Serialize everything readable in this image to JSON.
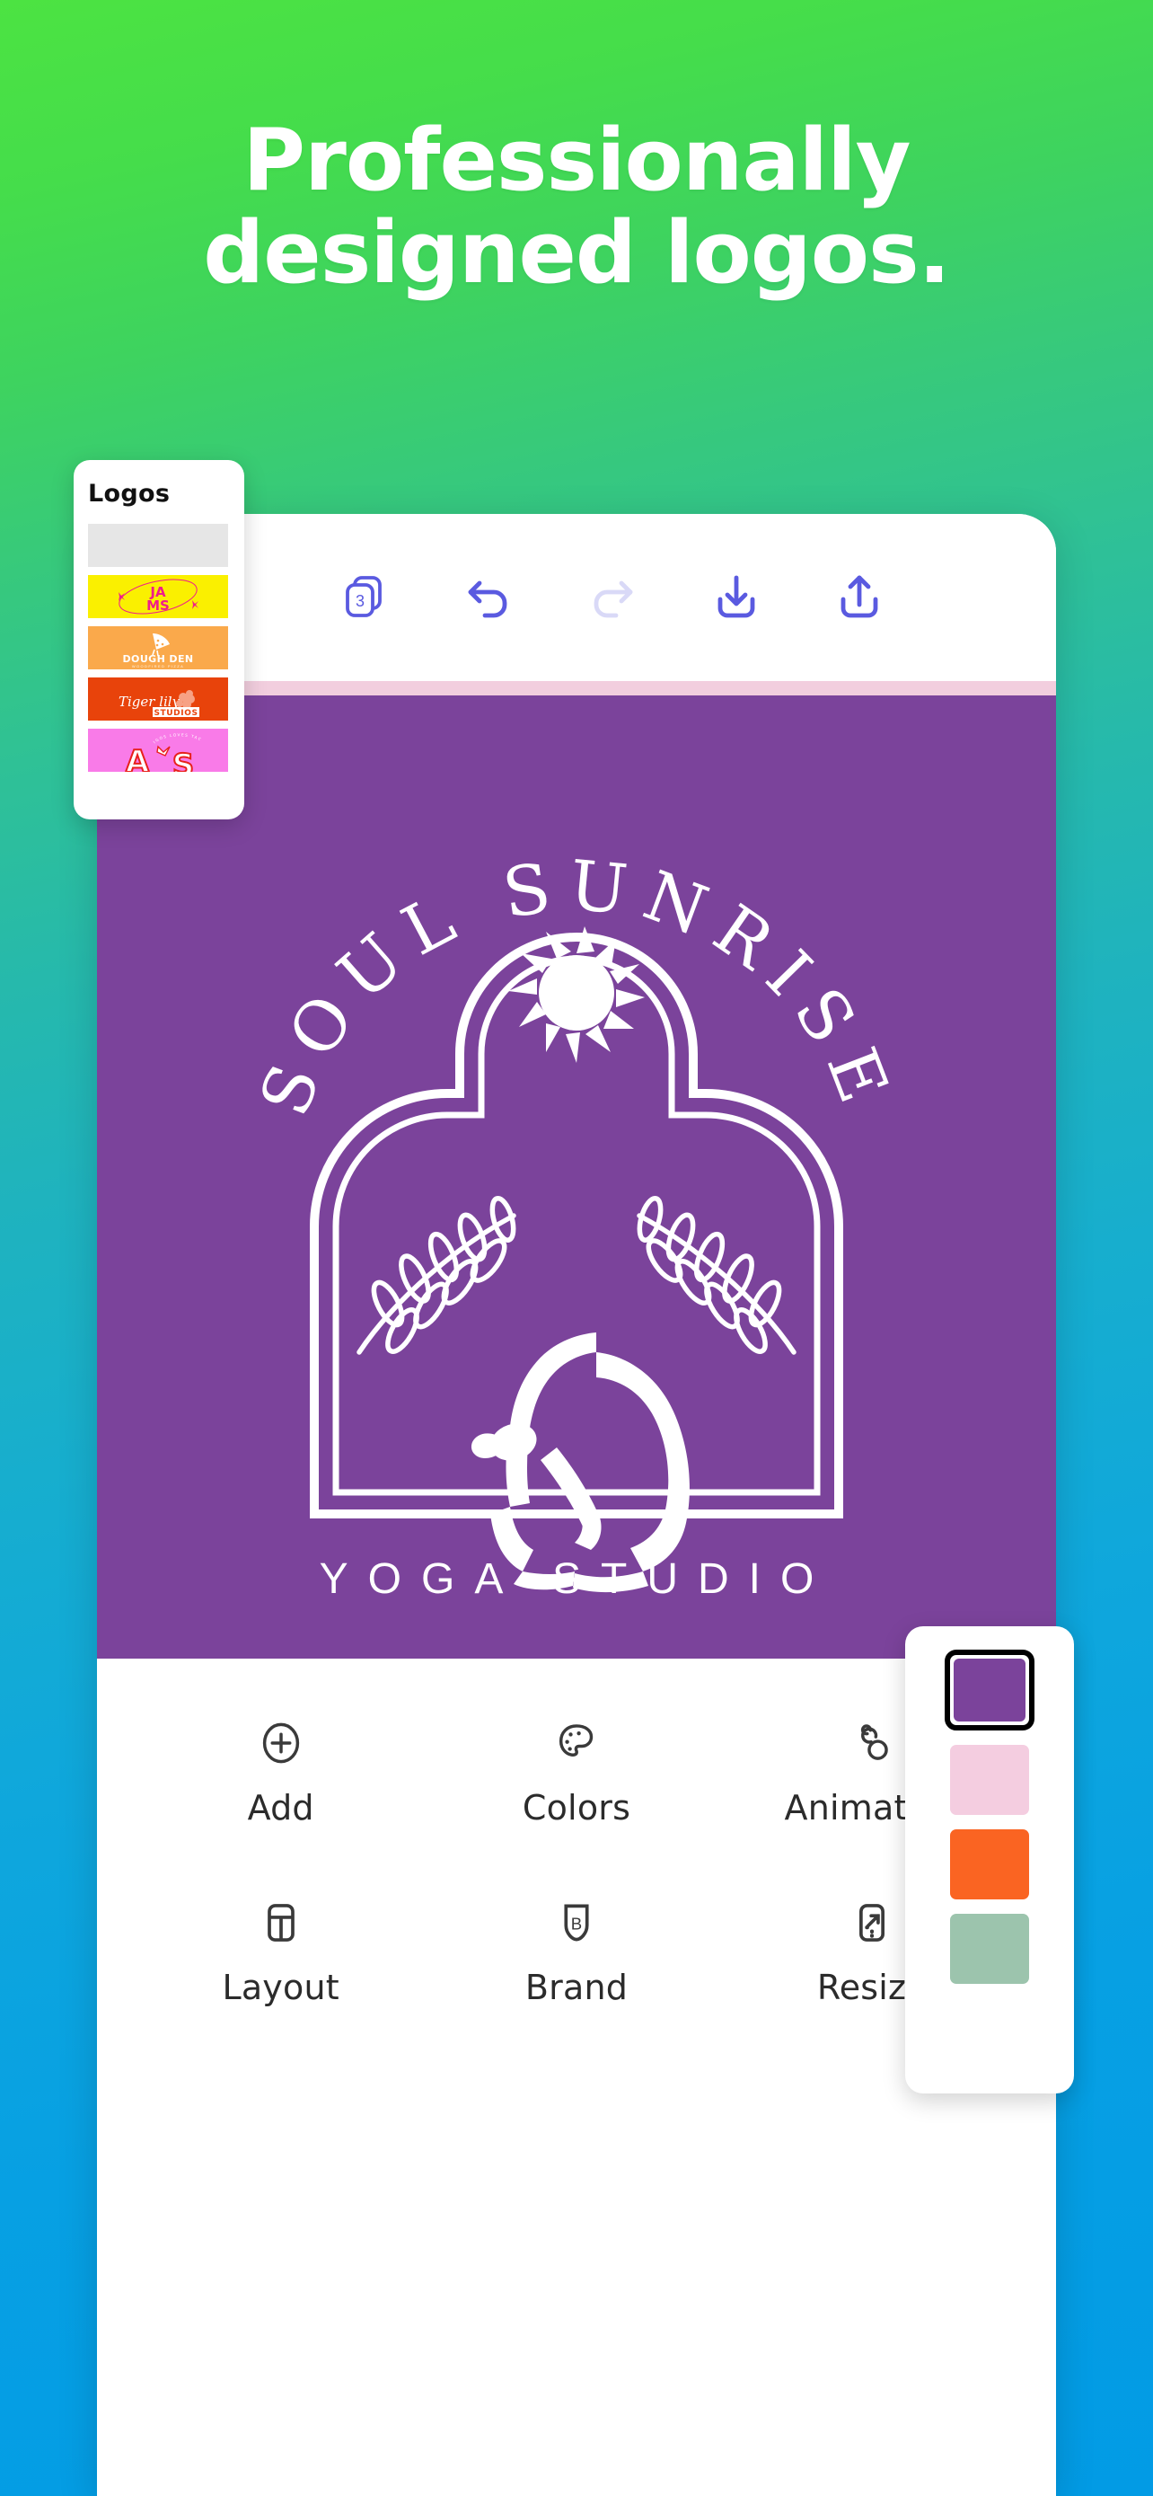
{
  "headline": {
    "line1": "Professionally",
    "line2": "designed logos."
  },
  "background": {
    "gradient_from": "#4CE342",
    "gradient_mid": "#1FB3BE",
    "gradient_to": "#029BE5"
  },
  "app": {
    "top_toolbar": {
      "pages": {
        "label": "Pages",
        "badge": "3",
        "icon": "pages-icon",
        "color": "#5A5AE0"
      },
      "undo": {
        "label": "Undo",
        "icon": "undo-icon",
        "color": "#5A5AE0",
        "enabled": true
      },
      "redo": {
        "label": "Redo",
        "icon": "redo-icon",
        "color": "#D9D9F7",
        "enabled": false
      },
      "download": {
        "label": "Download",
        "icon": "download-icon",
        "color": "#5A5AE0"
      },
      "share": {
        "label": "Share",
        "icon": "share-icon",
        "color": "#5A5AE0"
      }
    },
    "canvas": {
      "background_color": "#7B439B",
      "accent_strip_color": "#F2CEDE",
      "logo": {
        "arc_text": "SOUL SUNRISE",
        "subtitle": "YOGA STUDIO",
        "motifs": [
          "sun",
          "arch-frame",
          "fern-leaves",
          "yoga-pose"
        ],
        "ink_color": "#FFFFFF"
      }
    },
    "bottom_tools": [
      {
        "label": "Add",
        "icon": "plus-circle-icon"
      },
      {
        "label": "Colors",
        "icon": "palette-icon"
      },
      {
        "label": "Animation",
        "icon": "animation-icon"
      },
      {
        "label": "Layout",
        "icon": "layout-icon"
      },
      {
        "label": "Brand",
        "icon": "brand-shield-icon"
      },
      {
        "label": "Resize",
        "icon": "resize-icon"
      }
    ]
  },
  "logos_panel": {
    "title": "Logos",
    "items": [
      {
        "name": "blank-placeholder",
        "label": "",
        "bg": "#E6E6E6"
      },
      {
        "name": "jams",
        "label": "JA MS",
        "bg": "#FAF000",
        "ink": "#F01C8C"
      },
      {
        "name": "dough-den",
        "label": "DOUGH DEN",
        "sublabel": "WOODFIRED PIZZA",
        "bg": "#FAA94B",
        "ink": "#FFFFFF"
      },
      {
        "name": "tiger-lily-studios",
        "label": "Tiger lily",
        "sublabel": "STUDIOS",
        "bg": "#E8430B",
        "ink": "#FFFFFF"
      },
      {
        "name": "amigos",
        "label": "A S",
        "sublabel": "AMIGOS LOVES TACOS",
        "bg": "#F97BE8",
        "ink": "#E8201B"
      }
    ]
  },
  "colors_panel": {
    "swatches": [
      {
        "name": "purple",
        "hex": "#7B439B",
        "selected": true
      },
      {
        "name": "light-pink",
        "hex": "#F4CDE0",
        "selected": false
      },
      {
        "name": "orange",
        "hex": "#FA6422",
        "selected": false
      },
      {
        "name": "sage-green",
        "hex": "#9CC4AD",
        "selected": false
      }
    ]
  }
}
